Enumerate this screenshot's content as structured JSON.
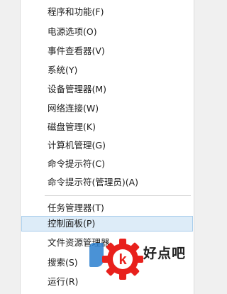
{
  "menu": {
    "items": [
      "程序和功能(F)",
      "电源选项(O)",
      "事件查看器(V)",
      "系统(Y)",
      "设备管理器(M)",
      "网络连接(W)",
      "磁盘管理(K)",
      "计算机管理(G)",
      "命令提示符(C)",
      "命令提示符(管理员)(A)",
      "任务管理器(T)",
      "控制面板(P)",
      "文件资源管理器",
      "搜索(S)",
      "运行(R)"
    ],
    "highlighted_index": 11
  },
  "watermark": {
    "text": "好点吧",
    "gear_color": "#e8201c"
  }
}
